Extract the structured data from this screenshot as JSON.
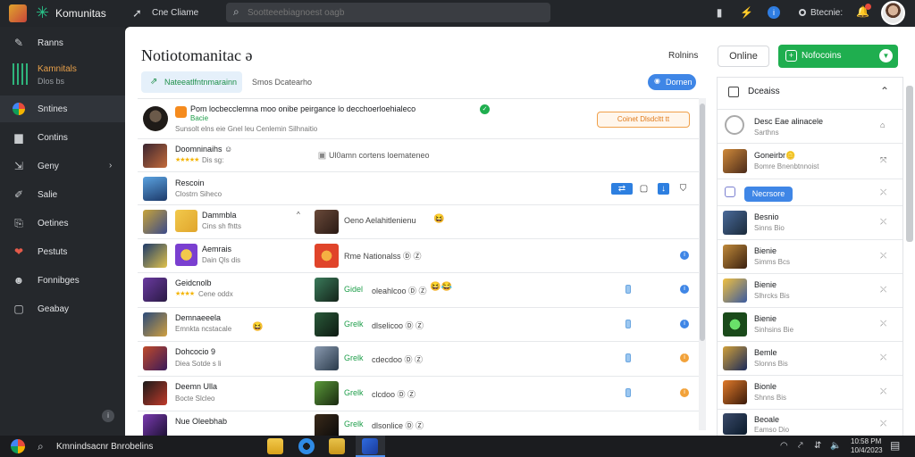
{
  "topbar": {
    "brand": "Komunitas",
    "nav_link": "Cne Cliame",
    "search_placeholder": "Sootteeebiagnoest oagb",
    "status_label": "Btecnie:"
  },
  "sidebar": {
    "community_title": "Kamnitals",
    "community_sub": "Dlos bs",
    "items": [
      {
        "label": "Ranns",
        "icon": "wrench-icon"
      },
      {
        "label": "Sntines",
        "icon": "chrome-icon"
      },
      {
        "label": "Contins",
        "icon": "folder-icon"
      },
      {
        "label": "Geny",
        "icon": "export-icon"
      },
      {
        "label": "Salie",
        "icon": "edit-icon"
      },
      {
        "label": "Oetines",
        "icon": "share-icon"
      },
      {
        "label": "Pestuts",
        "icon": "heart-icon"
      },
      {
        "label": "Fonnibges",
        "icon": "people-icon"
      },
      {
        "label": "Geabay",
        "icon": "chat-icon"
      }
    ]
  },
  "header": {
    "title": "Notiotomanitac ə",
    "link": "Rolnins",
    "online_button": "Online",
    "primary_button": "Nofocoins"
  },
  "tabs": {
    "active": "Nateeatlfntnmarainn",
    "second": "Smos Dcatearho",
    "pill": "Dornen"
  },
  "promo": {
    "title": "Pom locbecclemna moo onibe peirgance lo decchoerloehialeco",
    "rating_label": "Bacie",
    "sub": "Sunsolt elns eie Gnel leu Cenlemin Silhnaitio",
    "badge": "Coinet Dlsdcltt tt"
  },
  "rows": [
    {
      "title": "Doomninaihs ☺",
      "sub": "Dis sg:",
      "middle": "Ul0amn cortens loemateneo"
    },
    {
      "title": "Rescoin",
      "sub": "Clostrn Siheco"
    },
    {
      "title": "Dammbla",
      "sub": "Cins sh fhtts",
      "middle": "Oeno Aelahitlenienu",
      "emoji": "😆"
    },
    {
      "title": "Aemrais",
      "sub": "Dain Qls dis",
      "middle": "Rme Nationalss Ⓓ Ⓩ"
    },
    {
      "title": "Geidcnolb",
      "sub": "Cene oddx",
      "middle_green": "Gidel",
      "middle": "oleahlcoo Ⓓ Ⓩ",
      "emoji": "😆😂"
    },
    {
      "title": "Demnaeeela",
      "sub": "Emnkta ncstacale",
      "middle_green": "Grelk",
      "middle": "dlselicoo Ⓓ Ⓩ"
    },
    {
      "title": "Dohcocio 9",
      "sub": "Diea Sotde s li",
      "middle_green": "Grelk",
      "middle": "cdecdoo Ⓓ Ⓩ"
    },
    {
      "title": "Deemn Ulla",
      "sub": "Bocte Slcleo",
      "middle_green": "Grelk",
      "middle": "clcdoo Ⓓ Ⓩ"
    },
    {
      "title": "Nue Oleebhab",
      "sub": "",
      "middle_green": "Grelk",
      "middle": "dlsonlice Ⓓ Ⓩ"
    }
  ],
  "right_panel": {
    "header": "Dceaiss",
    "items": [
      {
        "t1": "Desc Eae alinacele",
        "t2": "Sarthns"
      },
      {
        "t1": "Goneirbr🪙",
        "t2": "Bomre Bnenbtnnoist"
      },
      {
        "pill": "Necrsore"
      },
      {
        "t1": "Besnio",
        "t2": "Sinns Bio"
      },
      {
        "t1": "Bienie",
        "t2": "Simms Bcs"
      },
      {
        "t1": "Bienie",
        "t2": "Slhrcks Bis"
      },
      {
        "t1": "Bienie",
        "t2": "Sinhsins Bie"
      },
      {
        "t1": "Bemle",
        "t2": "Slonns Bis"
      },
      {
        "t1": "Bionle",
        "t2": "Shnns Bis"
      },
      {
        "t1": "Beoale",
        "t2": "Eamso Dio"
      }
    ]
  },
  "taskbar": {
    "search_label": "Kmnindsacnr",
    "search_label2": "Bnrobelins",
    "clock_time": "10:58 PM",
    "clock_date": "10/4/2023"
  }
}
